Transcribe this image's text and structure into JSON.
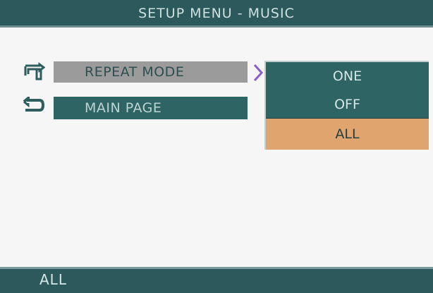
{
  "header": {
    "title": "SETUP MENU - MUSIC"
  },
  "menu": {
    "items": [
      {
        "label": "REPEAT MODE",
        "icon": "repeat-icon",
        "state": "highlighted"
      },
      {
        "label": "MAIN PAGE",
        "icon": "return-icon"
      }
    ]
  },
  "submenu": {
    "options": [
      {
        "label": "ONE"
      },
      {
        "label": "OFF"
      },
      {
        "label": "ALL",
        "selected": true
      }
    ]
  },
  "footer": {
    "status": "ALL"
  },
  "colors": {
    "bar": "#2c5a5c",
    "item_highlight": "#9b9b9b",
    "item": "#2f6464",
    "selected_option": "#e0a46e",
    "arrow": "#8a5cc8"
  }
}
